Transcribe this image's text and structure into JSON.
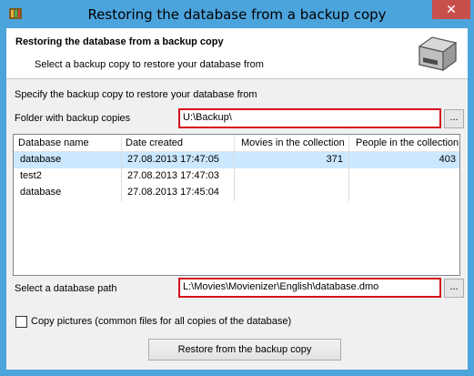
{
  "window": {
    "title": "Restoring the database from a backup copy",
    "close_glyph": "✕",
    "app_icon": "film-archive-icon",
    "accent_color": "#4ca4dd"
  },
  "header": {
    "title": "Restoring the database from a backup copy",
    "subtitle": "Select a backup copy to restore your database from",
    "icon": "disk-drive-icon"
  },
  "specify_label": "Specify the backup copy to restore your database from",
  "folder": {
    "label": "Folder with backup copies",
    "value": "U:\\Backup\\",
    "browse_label": "..."
  },
  "table": {
    "columns": [
      "Database name",
      "Date created",
      "Movies in the collection",
      "People in the collection"
    ],
    "rows": [
      {
        "name": "database",
        "date": "27.08.2013 17:47:05",
        "movies": "371",
        "people": "403"
      },
      {
        "name": "test2",
        "date": "27.08.2013 17:47:03",
        "movies": "",
        "people": ""
      },
      {
        "name": "database",
        "date": "27.08.2013 17:45:04",
        "movies": "",
        "people": ""
      }
    ],
    "selected_row": 0
  },
  "db_path": {
    "label": "Select a database path",
    "value": "L:\\Movies\\Movienizer\\English\\database.dmo",
    "browse_label": "..."
  },
  "copy_pictures": {
    "label": "Copy pictures (common files for all copies of the database)",
    "checked": false
  },
  "restore_button_label": "Restore from the backup copy",
  "highlight_color": "#d7101a"
}
